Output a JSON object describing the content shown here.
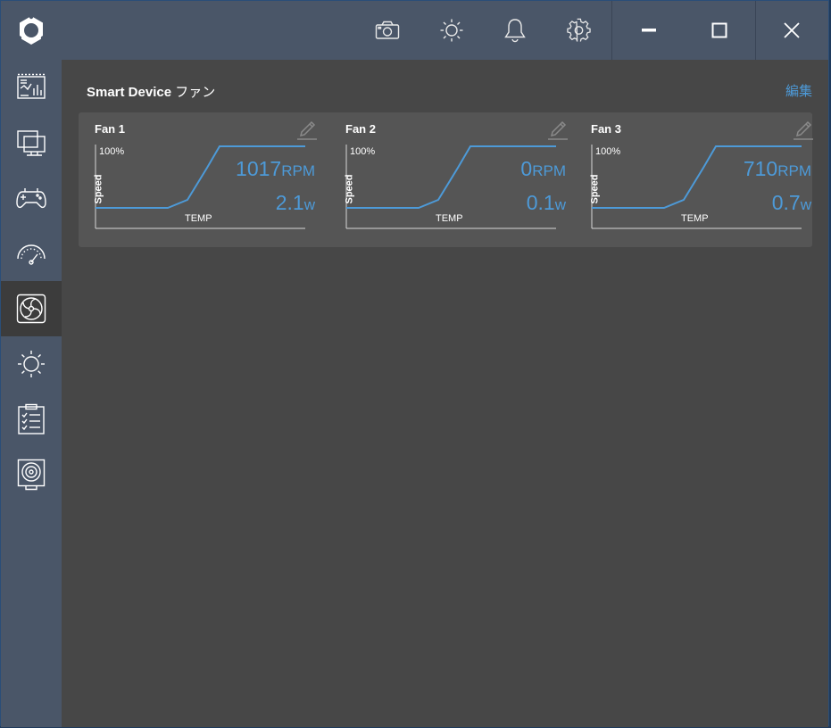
{
  "titlebar": {
    "buttons": [
      "camera-icon",
      "brightness-icon",
      "bell-icon",
      "gear-icon"
    ],
    "window_controls": [
      "minimize-icon",
      "maximize-icon",
      "close-icon"
    ]
  },
  "sidebar": {
    "items": [
      {
        "icon": "dashboard-icon"
      },
      {
        "icon": "computer-icon"
      },
      {
        "icon": "gamepad-icon"
      },
      {
        "icon": "speedometer-icon"
      },
      {
        "icon": "fan-icon",
        "active": true
      },
      {
        "icon": "sun-icon"
      },
      {
        "icon": "clipboard-checklist-icon"
      },
      {
        "icon": "webcam-icon"
      }
    ]
  },
  "main": {
    "title": "Smart Device",
    "title_sub": "ファン",
    "edit_label": "編集",
    "fans": [
      {
        "name": "Fan 1",
        "rpm": "1017",
        "rpm_unit": "RPM",
        "watt": "2.1",
        "watt_unit": "W",
        "max_label": "100%",
        "y_label": "Speed",
        "x_label": "TEMP"
      },
      {
        "name": "Fan 2",
        "rpm": "0",
        "rpm_unit": "RPM",
        "watt": "0.1",
        "watt_unit": "W",
        "max_label": "100%",
        "y_label": "Speed",
        "x_label": "TEMP"
      },
      {
        "name": "Fan 3",
        "rpm": "710",
        "rpm_unit": "RPM",
        "watt": "0.7",
        "watt_unit": "W",
        "max_label": "100%",
        "y_label": "Speed",
        "x_label": "TEMP"
      }
    ]
  },
  "colors": {
    "accent": "#4d9ad8",
    "sidebar_bg": "#4a5668",
    "main_bg": "#474747",
    "panel_bg": "#555555"
  }
}
